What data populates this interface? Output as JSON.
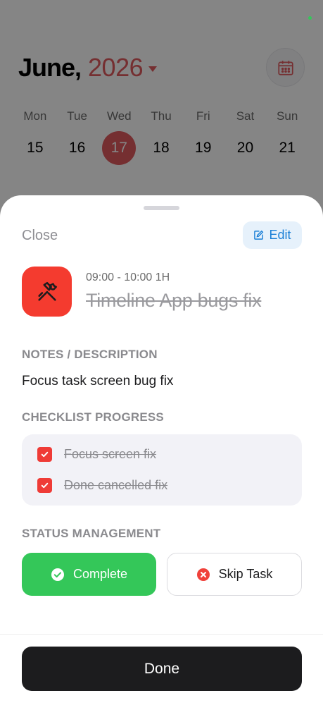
{
  "calendar": {
    "month": "June,",
    "year": "2026",
    "days": [
      {
        "name": "Mon",
        "num": "15"
      },
      {
        "name": "Tue",
        "num": "16"
      },
      {
        "name": "Wed",
        "num": "17"
      },
      {
        "name": "Thu",
        "num": "18"
      },
      {
        "name": "Fri",
        "num": "19"
      },
      {
        "name": "Sat",
        "num": "20"
      },
      {
        "name": "Sun",
        "num": "21"
      }
    ],
    "selected_day": "17"
  },
  "sheet": {
    "close_label": "Close",
    "edit_label": "Edit",
    "task_time": "09:00 - 10:00 1H",
    "task_title": "Timeline App bugs fix",
    "task_icon": "hammer-wrench-icon",
    "notes_heading": "NOTES / DESCRIPTION",
    "notes_text": "Focus task screen bug fix",
    "checklist_heading": "CHECKLIST PROGRESS",
    "checklist": [
      {
        "label": "Focus screen fix",
        "checked": true
      },
      {
        "label": "Done cancelled fix",
        "checked": true
      }
    ],
    "status_heading": "STATUS MANAGEMENT",
    "complete_label": "Complete",
    "skip_label": "Skip Task",
    "done_label": "Done"
  },
  "colors": {
    "accent": "#e05a5f",
    "task_icon_bg": "#f43b2f",
    "complete_bg": "#34c759",
    "edit_text": "#1a7fd6",
    "done_bg": "#1c1c1e"
  }
}
